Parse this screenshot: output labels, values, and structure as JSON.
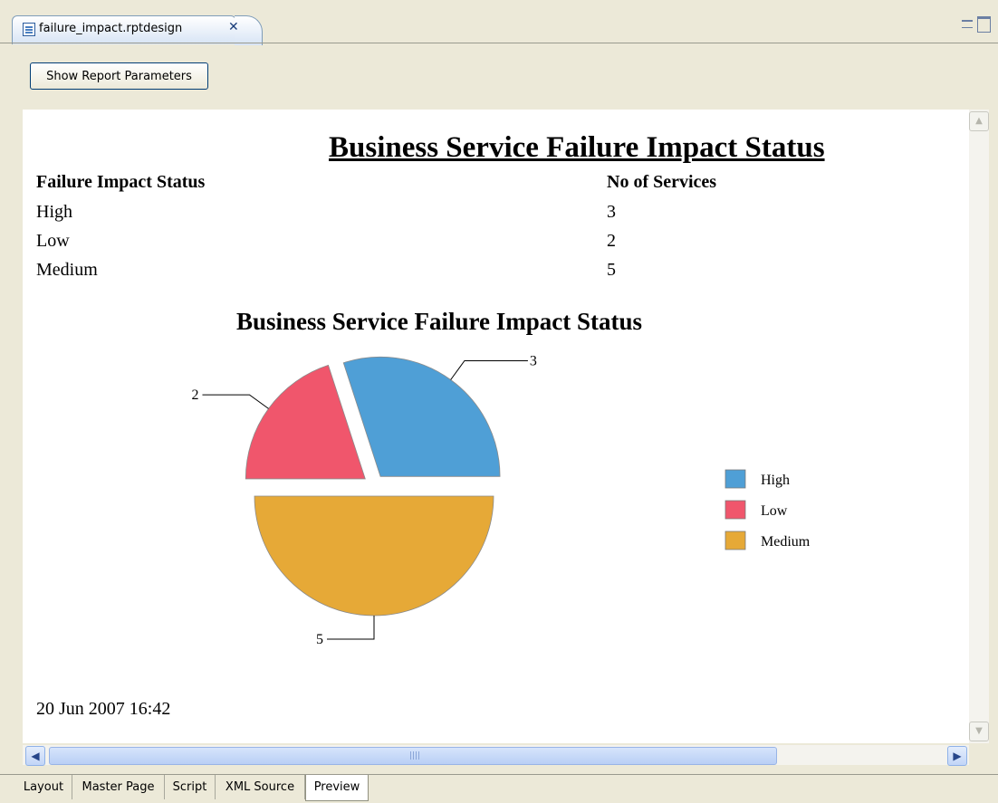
{
  "editor": {
    "tab_title": "failure_impact.rptdesign",
    "close_glyph": "✕",
    "show_params_label": "Show Report Parameters"
  },
  "report": {
    "title": "Business Service Failure Impact Status",
    "table": {
      "headers": [
        "Failure Impact Status",
        "No of Services"
      ],
      "rows": [
        [
          "High",
          "3"
        ],
        [
          "Low",
          "2"
        ],
        [
          "Medium",
          "5"
        ]
      ]
    },
    "date": "20 Jun 2007 16:42"
  },
  "chart_data": {
    "type": "pie",
    "title": "Business Service Failure Impact Status",
    "categories": [
      "High",
      "Low",
      "Medium"
    ],
    "values": [
      3,
      2,
      5
    ],
    "colors": [
      "#4f9fd6",
      "#f0566c",
      "#e6a937"
    ],
    "exploded": true,
    "legend_position": "right"
  },
  "scrollbars": {
    "up_glyph": "▲",
    "down_glyph": "▼",
    "left_glyph": "◀",
    "right_glyph": "▶"
  },
  "bottom_tabs": [
    "Layout",
    "Master Page",
    "Script",
    "XML Source",
    "Preview"
  ],
  "active_bottom_tab": "Preview"
}
